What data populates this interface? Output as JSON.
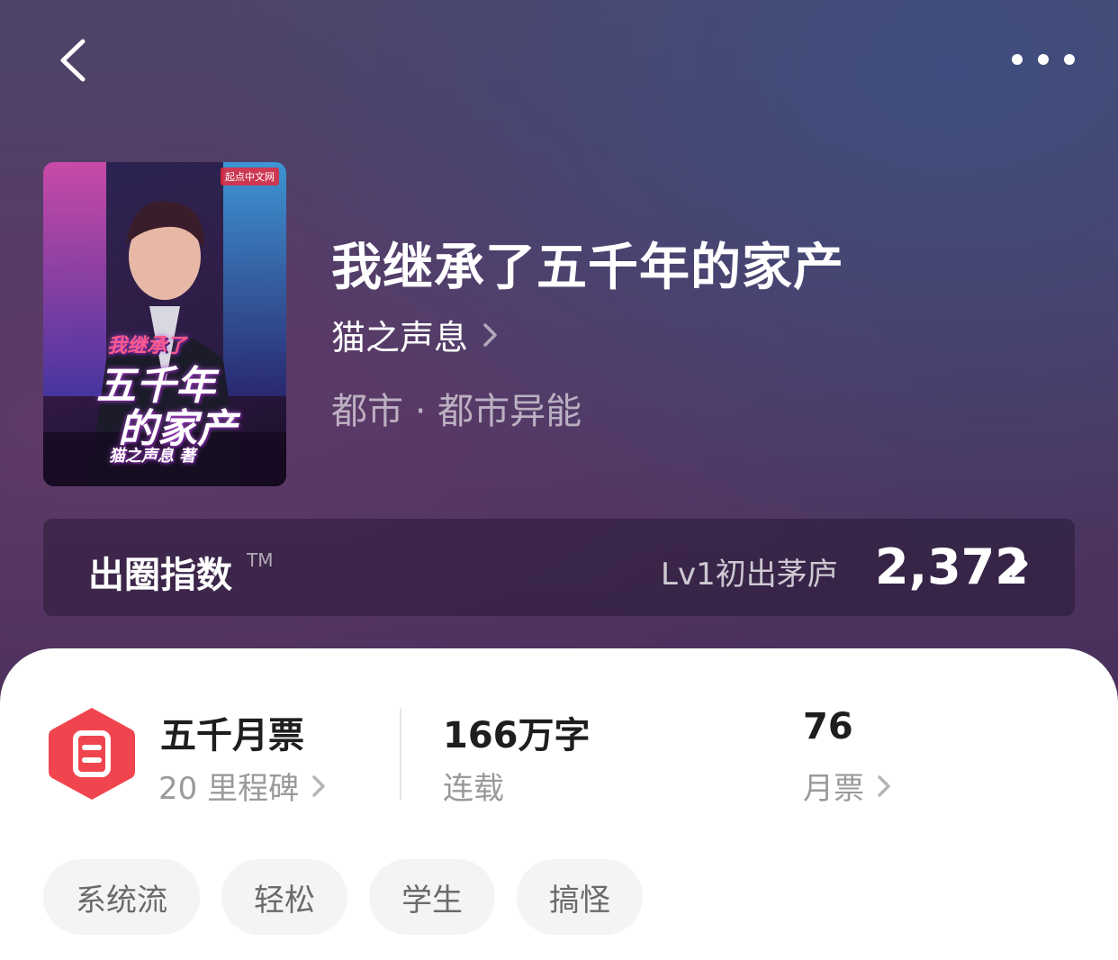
{
  "book": {
    "title": "我继承了五千年的家产",
    "author": "猫之声息",
    "genre": "都市 · 都市异能",
    "cover": {
      "publisher": "起点中文网",
      "title_line1": "我继承了",
      "title_line2": "五千年",
      "title_line3": "的家产",
      "author": "猫之声息 著"
    }
  },
  "index": {
    "label": "出圈指数",
    "tm": "TM",
    "level": "Lv1初出茅庐",
    "score": "2,372"
  },
  "stats": {
    "milestone": {
      "title": "五千月票",
      "sub": "20 里程碑"
    },
    "words": {
      "title": "166万字",
      "sub": "连载"
    },
    "tickets": {
      "title": "76",
      "sub": "月票"
    }
  },
  "tags": [
    "系统流",
    "轻松",
    "学生",
    "搞怪"
  ],
  "icons": {
    "back": "chevron-left-icon",
    "more": "more-dots-icon",
    "badge": "monthly-ticket-badge-icon"
  },
  "colors": {
    "badge": "#f0454f",
    "accent_text": "#1e1e1e"
  }
}
